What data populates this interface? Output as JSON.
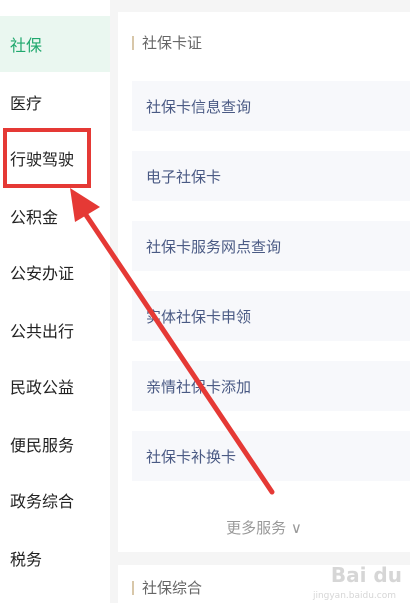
{
  "sidebar": {
    "items": [
      {
        "label": "社保",
        "active": true
      },
      {
        "label": "医疗"
      },
      {
        "label": "行驶驾驶"
      },
      {
        "label": "公积金"
      },
      {
        "label": "公安办证"
      },
      {
        "label": "公共出行"
      },
      {
        "label": "民政公益"
      },
      {
        "label": "便民服务"
      },
      {
        "label": "政务综合"
      },
      {
        "label": "税务"
      }
    ]
  },
  "main": {
    "section1_title": "社保卡证",
    "cards": [
      "社保卡信息查询",
      "电子社保卡",
      "社保卡服务网点查询",
      "实体社保卡申领",
      "亲情社保卡添加",
      "社保卡补换卡"
    ],
    "more_label": "更多服务 ∨",
    "section2_title": "社保综合"
  },
  "colors": {
    "accent_green": "#1fa86d",
    "highlight_red": "#e53935",
    "card_text": "#4a5a84"
  },
  "watermark": {
    "text": "Bai du",
    "sub": "jingyan.baidu.com"
  }
}
